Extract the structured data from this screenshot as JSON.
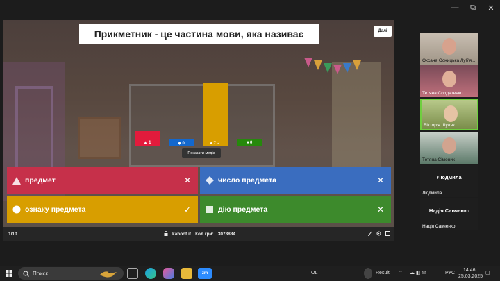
{
  "window": {
    "minimize": "—",
    "maximize": "⧉",
    "close": "✕"
  },
  "quiz": {
    "question": "Прикметник - це частина мови, яка називає",
    "next_label": "Далі",
    "bars": [
      {
        "count": "1",
        "symbol": "▲",
        "color": "#e21b3c",
        "value": 1
      },
      {
        "count": "0",
        "symbol": "◆",
        "color": "#1368ce",
        "value": 0
      },
      {
        "count": "7",
        "symbol": "●",
        "check": "✓",
        "color": "#d89e00",
        "value": 7
      },
      {
        "count": "0",
        "symbol": "■",
        "color": "#26890c",
        "value": 0
      }
    ],
    "tooltip": "Показати медіа",
    "answers": [
      {
        "text": "предмет",
        "mark": "✕",
        "color": "#c6304a"
      },
      {
        "text": "число предмета",
        "mark": "✕",
        "color": "#3a6dbf"
      },
      {
        "text": "ознаку предмета",
        "mark": "✓",
        "color": "#d89e00"
      },
      {
        "text": "дію предмета",
        "mark": "✕",
        "color": "#3d8a2c"
      }
    ],
    "footer": {
      "progress": "1/10",
      "site": "kahoot.it",
      "pin_label": "Код гри:",
      "pin": "3073884"
    }
  },
  "participants": [
    {
      "name": "Оксана Осницька Луб'я...",
      "type": "video"
    },
    {
      "name": "Тетяна Солдатенко",
      "type": "video"
    },
    {
      "name": "Вікторія Шуляк",
      "type": "video"
    },
    {
      "name": "Тетяна Сіменик",
      "type": "video"
    },
    {
      "name": "Людмила",
      "title": "Людмила",
      "type": "plain"
    },
    {
      "name": "Надія Савченко",
      "title": "Надія Савченко",
      "type": "plain"
    }
  ],
  "taskbar": {
    "search_placeholder": "Поиск",
    "ol_label": "OL",
    "result_label": "Result",
    "lang": "РУС",
    "time": "14:46",
    "date": "25.03.2025"
  }
}
